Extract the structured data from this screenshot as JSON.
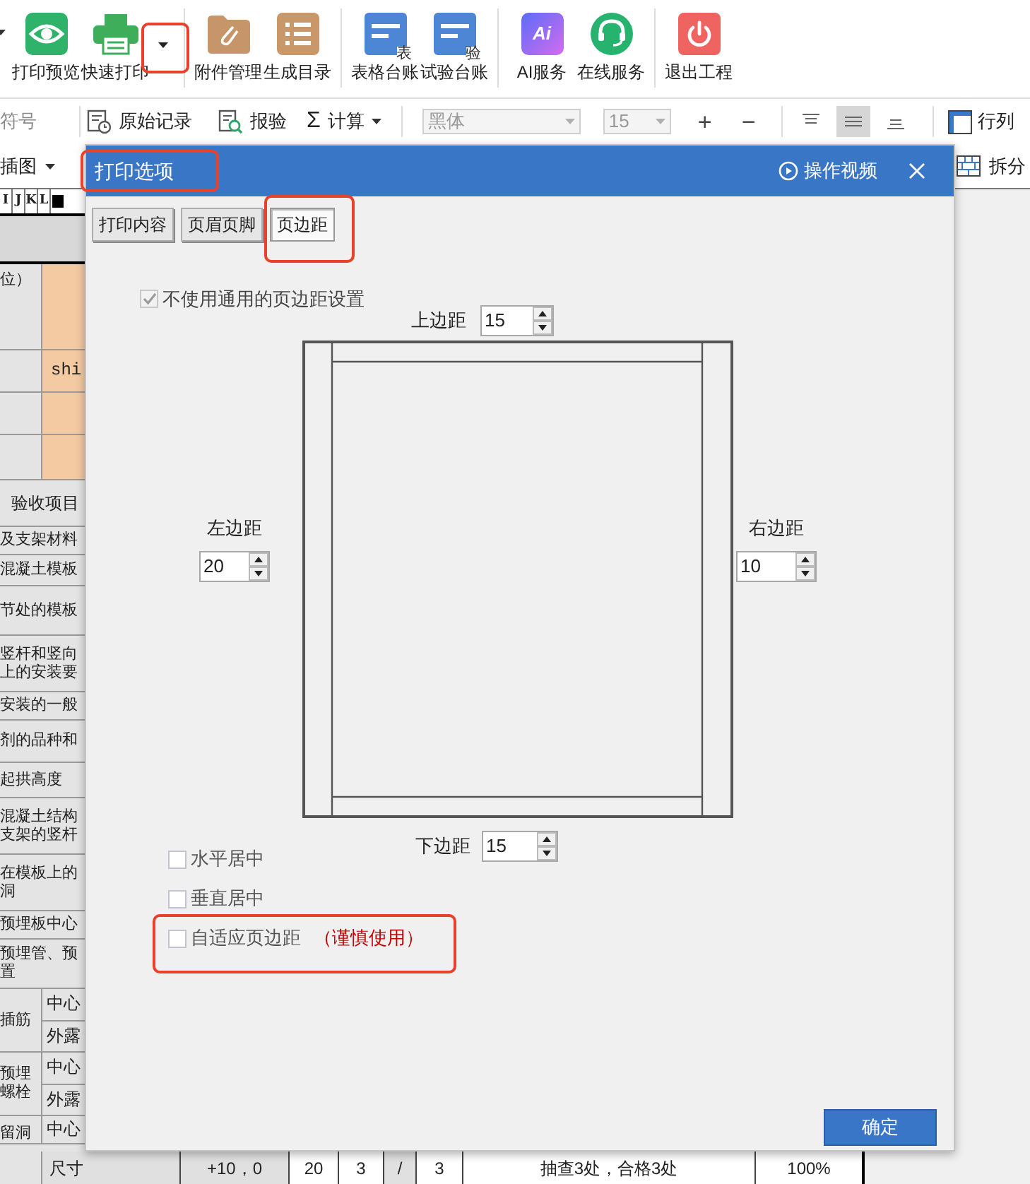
{
  "toolbar": {
    "groups": [
      [
        {
          "kind": "eye",
          "label": "打印预览",
          "dropdown": false
        },
        {
          "kind": "printer",
          "label": "快速打印",
          "dropdown": true
        }
      ],
      [
        {
          "kind": "folder",
          "label": "附件管理",
          "dropdown": false
        },
        {
          "kind": "list",
          "label": "生成目录",
          "dropdown": false
        }
      ],
      [
        {
          "kind": "ledger",
          "glyph": "表",
          "label": "表格台账",
          "dropdown": false
        },
        {
          "kind": "ledger",
          "glyph": "验",
          "label": "试验台账",
          "dropdown": false
        }
      ],
      [
        {
          "kind": "ai",
          "glyph": "Ai",
          "label": "AI服务",
          "dropdown": false
        },
        {
          "kind": "headset",
          "label": "在线服务",
          "dropdown": false
        }
      ],
      [
        {
          "kind": "power",
          "label": "退出工程",
          "dropdown": false
        }
      ]
    ]
  },
  "format_bar": {
    "symbol": "符号",
    "commands": [
      {
        "kind": "record",
        "label": "原始记录",
        "dropdown": false
      },
      {
        "kind": "inspect",
        "label": "报验",
        "dropdown": false
      },
      {
        "kind": "calc",
        "symbol": "Σ",
        "label": "计算",
        "dropdown": true
      }
    ],
    "font": {
      "value": "黑体",
      "disabled": true
    },
    "size": {
      "value": "15",
      "disabled": true
    },
    "steppers": [
      "+",
      "−"
    ],
    "align": [
      {
        "kind": "top",
        "selected": false
      },
      {
        "kind": "middle",
        "selected": true
      },
      {
        "kind": "bottom",
        "selected": false
      }
    ],
    "rowcol": "行列"
  },
  "insert_bar": {
    "insert": "插图",
    "split": "拆分"
  },
  "sheet": {
    "column_letters": [
      "I",
      "J",
      "K",
      "L"
    ],
    "rows": [
      {
        "kind": "split",
        "text": "位）"
      },
      {
        "kind": "split",
        "value": "shi"
      },
      {
        "kind": "split"
      },
      {
        "kind": "split"
      },
      {
        "kind": "title",
        "text": "验收项目"
      },
      {
        "kind": "label",
        "text": "及支架材料"
      },
      {
        "kind": "label",
        "text": "混凝土模板"
      },
      {
        "kind": "label",
        "text": "节处的模板"
      },
      {
        "kind": "label",
        "text": "竖杆和竖向上的安装要"
      },
      {
        "kind": "label",
        "text": "安装的一般"
      },
      {
        "kind": "label",
        "text": "剂的品种和"
      },
      {
        "kind": "label",
        "text": "起拱高度"
      },
      {
        "kind": "label",
        "text": "混凝土结构支架的竖杆"
      },
      {
        "kind": "label",
        "text": "在模板上的洞"
      },
      {
        "kind": "label",
        "text": "预埋板中心"
      },
      {
        "kind": "label",
        "text": "预埋管、预置"
      },
      {
        "kind": "pair",
        "text": "插筋",
        "sub": [
          "中心",
          "外露"
        ]
      },
      {
        "kind": "pair",
        "text": "预埋螺栓",
        "sub": [
          "中心",
          "外露"
        ]
      },
      {
        "kind": "pair",
        "text": "留洞",
        "sub": [
          "中心"
        ]
      }
    ],
    "bottom_row": [
      {
        "text": "尺寸",
        "shaded": true
      },
      {
        "text": "+10，0",
        "shaded": true
      },
      {
        "text": "20",
        "shaded": false
      },
      {
        "text": "3",
        "shaded": false
      },
      {
        "text": "/",
        "shaded": true
      },
      {
        "text": "3",
        "shaded": false
      },
      {
        "text": "抽查3处，合格3处",
        "shaded": false
      },
      {
        "text": "100%",
        "shaded": false
      }
    ]
  },
  "dialog": {
    "title": "打印选项",
    "video_link": "操作视频",
    "tabs": [
      {
        "label": "打印内容",
        "selected": false
      },
      {
        "label": "页眉页脚",
        "selected": false
      },
      {
        "label": "页边距",
        "selected": true
      }
    ],
    "custom_margins": {
      "label": "不使用通用的页边距设置",
      "checked": true,
      "disabled": true
    },
    "margins": {
      "top": {
        "label": "上边距",
        "value": "15"
      },
      "left": {
        "label": "左边距",
        "value": "20"
      },
      "right": {
        "label": "右边距",
        "value": "10"
      },
      "bottom": {
        "label": "下边距",
        "value": "15"
      }
    },
    "options": [
      {
        "label": "水平居中",
        "checked": false
      },
      {
        "label": "垂直居中",
        "checked": false
      },
      {
        "label": "自适应页边距",
        "note": "（谨慎使用）",
        "checked": false
      }
    ],
    "ok_button": "确定"
  }
}
